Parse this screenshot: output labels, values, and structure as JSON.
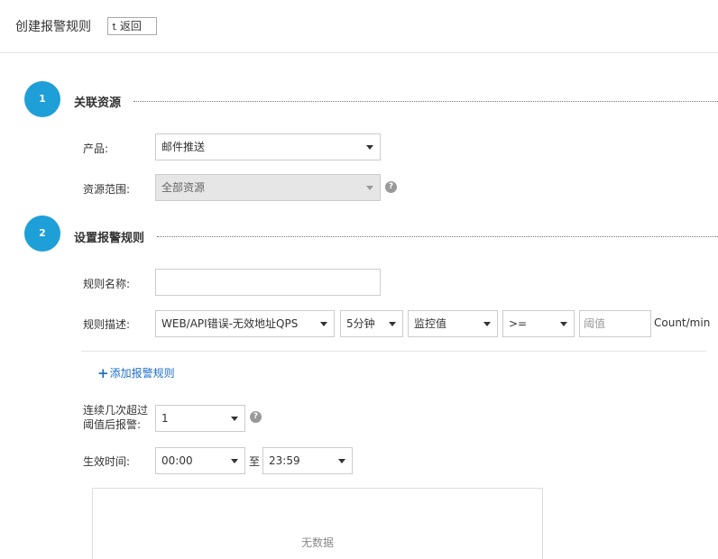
{
  "header": {
    "title": "创建报警规则",
    "back_label": "返回",
    "back_icon": "return-arrow-icon"
  },
  "section1": {
    "step": "1",
    "title": "关联资源",
    "product_label": "产品:",
    "product_value": "邮件推送",
    "scope_label": "资源范围:",
    "scope_value": "全部资源"
  },
  "section2": {
    "step": "2",
    "title": "设置报警规则",
    "rule_name_label": "规则名称:",
    "rule_name_value": "",
    "rule_desc_label": "规则描述:",
    "metric_value": "WEB/API错误-无效地址QPS",
    "period_value": "5分钟",
    "stat_value": "监控值",
    "operator_value": ">=",
    "threshold_placeholder": "阈值",
    "unit": "Count/min",
    "add_rule_label": "添加报警规则",
    "times_label_line1": "连续几次超过",
    "times_label_line2": "阈值后报警:",
    "times_value": "1",
    "effective_label": "生效时间:",
    "start_time": "00:00",
    "to_label": "至",
    "end_time": "23:59",
    "empty_text": "无数据"
  },
  "colors": {
    "accent": "#1e9fd8",
    "link": "#1e6fc8"
  }
}
